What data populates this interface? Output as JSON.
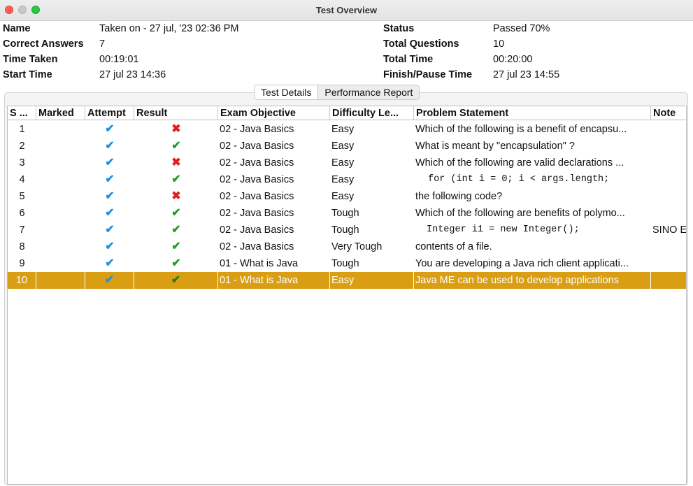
{
  "window": {
    "title": "Test Overview"
  },
  "summary": {
    "name_label": "Name",
    "name_value": "Taken on - 27 jul, '23 02:36 PM",
    "correct_label": "Correct Answers",
    "correct_value": "7",
    "time_taken_label": "Time Taken",
    "time_taken_value": "00:19:01",
    "start_time_label": "Start Time",
    "start_time_value": "27 jul 23 14:36",
    "status_label": "Status",
    "status_value": "Passed 70%",
    "total_questions_label": "Total Questions",
    "total_questions_value": "10",
    "total_time_label": "Total Time",
    "total_time_value": "00:20:00",
    "finish_label": "Finish/Pause Time",
    "finish_value": "27 jul 23 14:55"
  },
  "tabs": [
    {
      "label": "Test Details",
      "active": true
    },
    {
      "label": "Performance Report",
      "active": false
    }
  ],
  "table": {
    "headers": {
      "sno": "S ...",
      "marked": "Marked",
      "attempt": "Attempt",
      "result": "Result",
      "objective": "Exam Objective",
      "difficulty": "Difficulty Le...",
      "problem": "Problem Statement",
      "note": "Note"
    },
    "rows": [
      {
        "sno": "1",
        "marked": "",
        "attempt": "check",
        "result": "cross",
        "objective": "02 - Java Basics",
        "difficulty": "Easy",
        "problem": "Which of the following is a benefit of encapsu...",
        "note": ""
      },
      {
        "sno": "2",
        "marked": "",
        "attempt": "check",
        "result": "tick",
        "objective": "02 - Java Basics",
        "difficulty": "Easy",
        "problem": "What is meant by \"encapsulation\" ?",
        "note": ""
      },
      {
        "sno": "3",
        "marked": "",
        "attempt": "check",
        "result": "cross",
        "objective": "02 - Java Basics",
        "difficulty": "Easy",
        "problem": "Which of the following are valid declarations ...",
        "note": ""
      },
      {
        "sno": "4",
        "marked": "",
        "attempt": "check",
        "result": "tick",
        "objective": "02 - Java Basics",
        "difficulty": "Easy",
        "problem": "for (int i = 0; i < args.length;",
        "note": ""
      },
      {
        "sno": "5",
        "marked": "",
        "attempt": "check",
        "result": "cross",
        "objective": "02 - Java Basics",
        "difficulty": "Easy",
        "problem": "the following code?",
        "note": ""
      },
      {
        "sno": "6",
        "marked": "",
        "attempt": "check",
        "result": "tick",
        "objective": "02 - Java Basics",
        "difficulty": "Tough",
        "problem": "Which of the following are benefits of polymo...",
        "note": ""
      },
      {
        "sno": "7",
        "marked": "",
        "attempt": "check",
        "result": "tick",
        "objective": "02 - Java Basics",
        "difficulty": "Tough",
        "problem": "Integer i1 = new Integer();",
        "note": "SINO E"
      },
      {
        "sno": "8",
        "marked": "",
        "attempt": "check",
        "result": "tick",
        "objective": "02 - Java Basics",
        "difficulty": "Very Tough",
        "problem": "contents of a file.",
        "note": ""
      },
      {
        "sno": "9",
        "marked": "",
        "attempt": "check",
        "result": "tick",
        "objective": "01 - What is Java",
        "difficulty": "Tough",
        "problem": "You are developing a Java rich client applicati...",
        "note": ""
      },
      {
        "sno": "10",
        "marked": "",
        "attempt": "check",
        "result": "tick",
        "objective": "01 - What is Java",
        "difficulty": "Easy",
        "problem": "Java ME can be used to develop applications",
        "note": "",
        "selected": true
      }
    ]
  },
  "colors": {
    "selected_row": "#d99e14",
    "attempt_check": "#1f8fe0",
    "result_tick": "#1e9e1e",
    "result_cross": "#e02020"
  }
}
